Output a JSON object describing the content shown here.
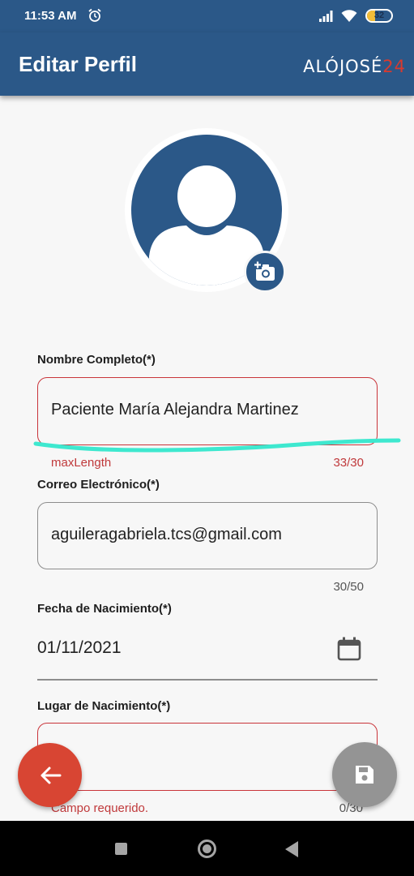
{
  "status_bar": {
    "time": "11:53 AM",
    "battery_level": "32",
    "battery_fraction": 0.32,
    "icons": [
      "alarm-icon",
      "signal-icon",
      "wifi-icon",
      "battery-icon"
    ]
  },
  "app_bar": {
    "title": "Editar Perfil",
    "logo_text": "ALÓJOSÉ",
    "logo_number": "24",
    "logo_number_color": "#d83a2e"
  },
  "colors": {
    "primary": "#2b5888",
    "error": "#c0393b",
    "fab_back": "#d84533",
    "fab_save": "#949494",
    "scribble": "#3ee8cf"
  },
  "form": {
    "full_name": {
      "label": "Nombre Completo(*)",
      "value": "Paciente María Alejandra Martinez",
      "helper": "maxLength",
      "counter": "33/30"
    },
    "email": {
      "label": "Correo Electrónico(*)",
      "value": "aguileragabriela.tcs@gmail.com",
      "counter": "30/50"
    },
    "birth_date": {
      "label": "Fecha de Nacimiento(*)",
      "value": "01/11/2021"
    },
    "birth_place": {
      "label": "Lugar de Nacimiento(*)",
      "value": "",
      "helper": "Campo requerido.",
      "counter": "0/30"
    }
  },
  "icons": {
    "avatar": "person-icon",
    "change_photo": "add-photo-icon",
    "calendar": "calendar-icon",
    "back": "arrow-back-icon",
    "save": "save-icon"
  }
}
